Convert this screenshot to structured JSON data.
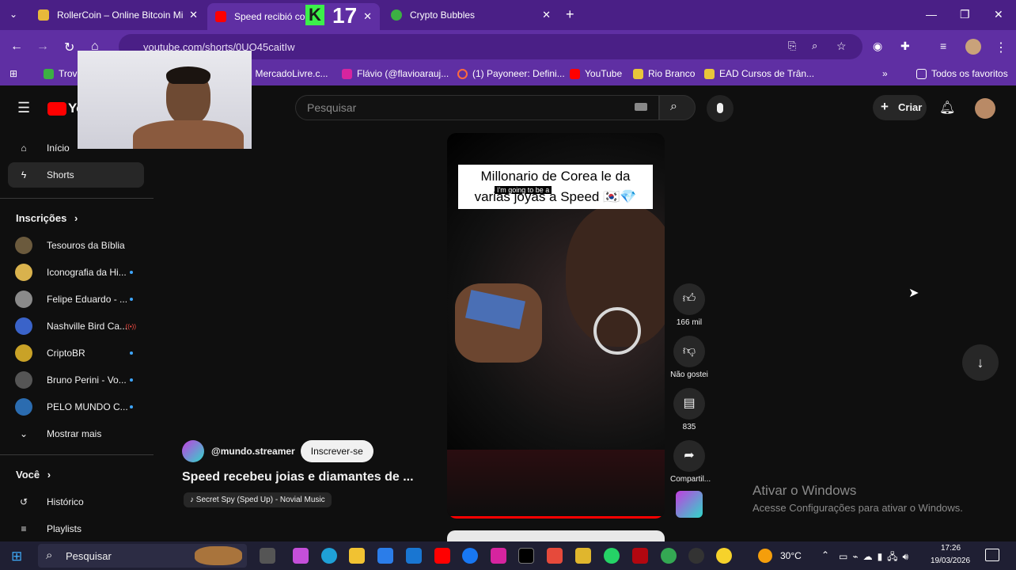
{
  "browser": {
    "tabs": [
      {
        "label": "RollerCoin – Online Bitcoin Mi",
        "favicon_color": "#e8b93a"
      },
      {
        "label": "Speed recibió com",
        "favicon_color": "#ff0000"
      },
      {
        "label": "Crypto Bubbles",
        "favicon_color": "#3cb043"
      }
    ],
    "overlay_badge": "17",
    "new_tab_label": "+",
    "url": "youtube.com/shorts/0UO45caitIw",
    "bookmarks": [
      "Trov",
      "| MercadoLivre.c...",
      "Flávio (@flavioarauj...",
      "(1) Payoneer: Defini...",
      "YouTube",
      "Rio Branco",
      "EAD Cursos de Trân..."
    ],
    "all_bookmarks": "Todos os favoritos"
  },
  "youtube": {
    "logo": "Yo",
    "search_placeholder": "Pesquisar",
    "create_label": "Criar",
    "sidebar": {
      "main": [
        {
          "label": "Início",
          "icon": "home-icon"
        },
        {
          "label": "Shorts",
          "icon": "shorts-icon",
          "selected": true
        }
      ],
      "subscriptions_header": "Inscrições",
      "subscriptions": [
        {
          "label": "Tesouros da Bíblia",
          "color": "#6b5a3d",
          "dot": false
        },
        {
          "label": "Iconografia da Hi...",
          "color": "#d9b24d",
          "dot": true
        },
        {
          "label": "Felipe Eduardo - ...",
          "color": "#8a8a8a",
          "dot": true
        },
        {
          "label": "Nashville Bird Ca...",
          "color": "#3a63c9",
          "dot": false,
          "live": true
        },
        {
          "label": "CriptoBR",
          "color": "#c9a227",
          "dot": true
        },
        {
          "label": "Bruno Perini - Vo...",
          "color": "#555555",
          "dot": true
        },
        {
          "label": "PELO MUNDO C...",
          "color": "#2b6cb0",
          "dot": true
        }
      ],
      "show_more": "Mostrar mais",
      "you_header": "Você",
      "you_items": [
        {
          "label": "Histórico",
          "icon": "history-icon"
        },
        {
          "label": "Playlists",
          "icon": "playlists-icon"
        }
      ]
    },
    "short": {
      "caption_line1": "Millonario de Corea le da",
      "caption_line2": "varias joyas a Speed 🇰🇷💎",
      "overlay_text": "I'm going to be a",
      "channel": "@mundo.streamer",
      "subscribe": "Inscrever-se",
      "title": "Speed recebeu joias e diamantes de ...",
      "music": "Secret Spy (Sped Up) - Novial Music",
      "likes": "166 mil",
      "dislike_label": "Não gostei",
      "comments": "835",
      "share_label": "Compartil..."
    },
    "watermark_title": "Ativar o Windows",
    "watermark_sub": "Acesse Configurações para ativar o Windows."
  },
  "taskbar": {
    "search": "Pesquisar",
    "temperature": "30°C",
    "time": "17:26",
    "date": "19/03/2026"
  }
}
